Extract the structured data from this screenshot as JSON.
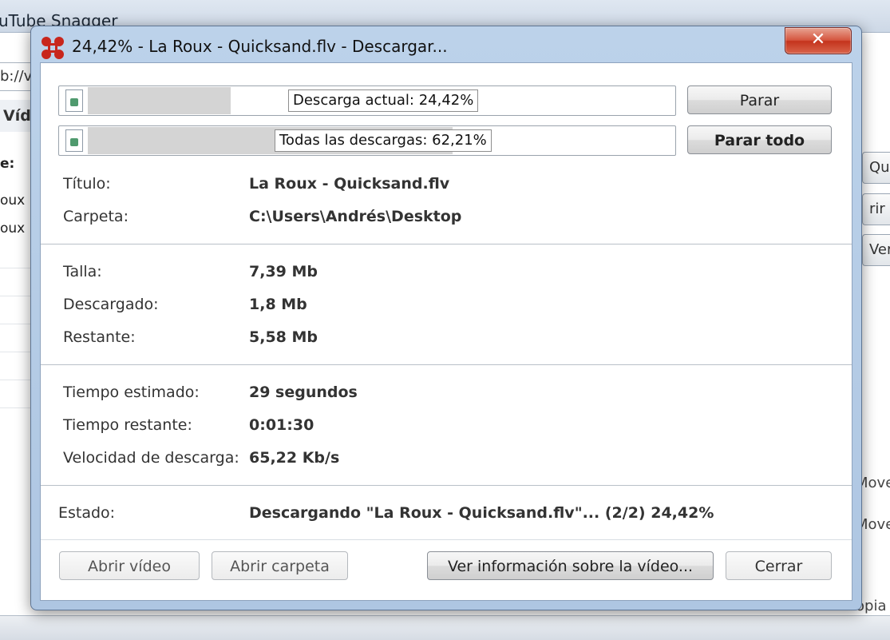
{
  "background": {
    "title": "uTube Snagger",
    "url_fragment": "b://v",
    "tab_label": "Víd",
    "column_header": "e:",
    "rows": [
      "oux",
      "oux"
    ],
    "right_buttons": [
      "Qui",
      "rir",
      "Ver"
    ],
    "right_texts": [
      "Move",
      "Move",
      "opia"
    ]
  },
  "dialog": {
    "title": "24,42% - La Roux - Quicksand.flv - Descargar...",
    "close_glyph": "✕",
    "current_progress": {
      "label": "Descarga actual: 24,42%",
      "fraction": 0.2442
    },
    "total_progress": {
      "label": "Todas las descargas: 62,21%",
      "fraction": 0.6221
    },
    "stop_button": "Parar",
    "stop_all_button": "Parar todo",
    "info": [
      {
        "label": "Título:",
        "value": "La Roux - Quicksand.flv"
      },
      {
        "label": "Carpeta:",
        "value": "C:\\Users\\Andrés\\Desktop"
      }
    ],
    "sizes": [
      {
        "label": "Talla:",
        "value": "7,39 Mb"
      },
      {
        "label": "Descargado:",
        "value": "1,8 Mb"
      },
      {
        "label": "Restante:",
        "value": "5,58 Mb"
      }
    ],
    "timing": [
      {
        "label": "Tiempo estimado:",
        "value": "29 segundos"
      },
      {
        "label": "Tiempo restante:",
        "value": "0:01:30"
      },
      {
        "label": "Velocidad de descarga:",
        "value": "65,22 Kb/s"
      }
    ],
    "status": {
      "label": "Estado:",
      "value": "Descargando \"La Roux - Quicksand.flv\"... (2/2) 24,42%"
    },
    "buttons": {
      "open_video": "Abrir vídeo",
      "open_folder": "Abrir carpeta",
      "view_info": "Ver información sobre la vídeo...",
      "close": "Cerrar"
    }
  },
  "colors": {
    "progress_fill": "#d4d4d4",
    "close_button": "#c4331d",
    "dialog_frame": "#aec6e2"
  }
}
